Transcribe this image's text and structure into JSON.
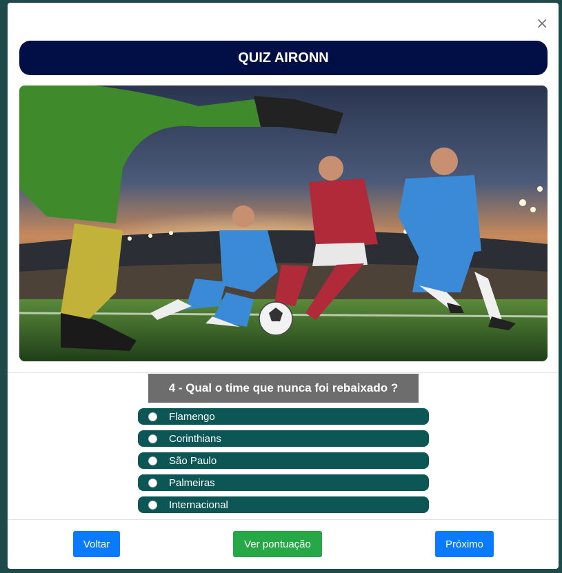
{
  "modal": {
    "close_glyph": "×",
    "title": "QUIZ AIRONN",
    "hero_image": "football-players-stadium-photo"
  },
  "question": {
    "text": "4 - Qual o time que nunca foi rebaixado ?",
    "options": [
      "Flamengo",
      "Corinthians",
      "São Paulo",
      "Palmeiras",
      "Internacional"
    ]
  },
  "footer": {
    "back_label": "Voltar",
    "score_label": "Ver pontuação",
    "next_label": "Próximo"
  },
  "colors": {
    "backdrop": "#1f4a4a",
    "title_bar": "#020e46",
    "question_bg": "#6d6d6d",
    "option_bg": "#0c5655",
    "primary": "#0a7bff",
    "success": "#27a846"
  }
}
